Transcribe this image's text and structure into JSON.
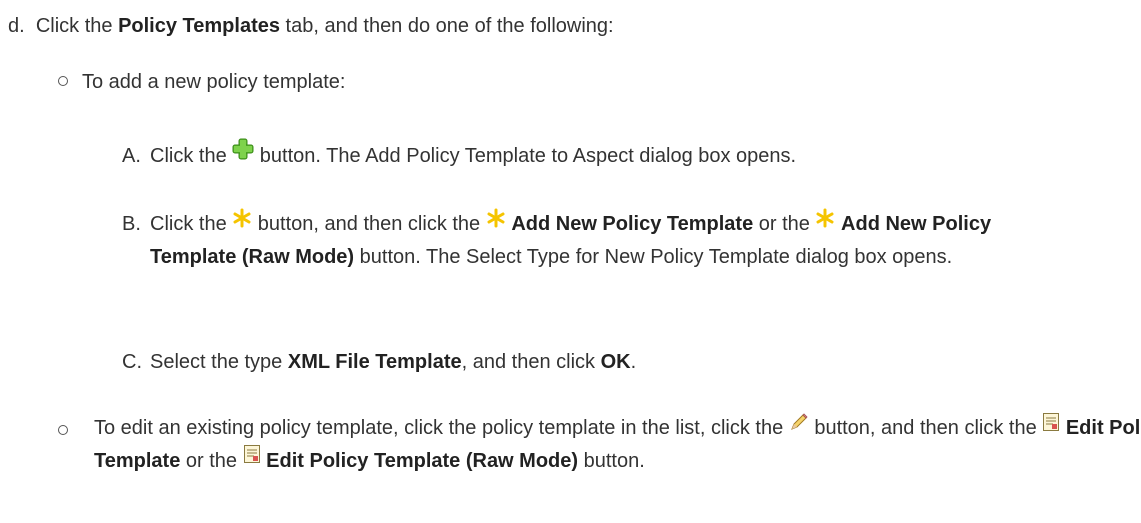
{
  "step_d": {
    "letter": "d.",
    "pre": "Click the ",
    "bold": "Policy Templates",
    "post": " tab, and then do one of the following:"
  },
  "bullet1": {
    "text": "To add a new policy template:"
  },
  "sub_a": {
    "letter": "A.",
    "pre": "Click the ",
    "post": " button. The Add Policy Template to Aspect dialog box opens.",
    "icon": "green-plus-icon"
  },
  "sub_b": {
    "letter": "B.",
    "pre": "Click the ",
    "mid1": " button, and then click the ",
    "bold1": "Add New Policy Template",
    "mid2": " or the ",
    "bold2": "Add New Policy Template (Raw Mode)",
    "post": " button. The Select Type for New Policy Template dialog box opens.",
    "icon": "asterisk-new-icon"
  },
  "sub_c": {
    "letter": "C.",
    "pre": "Select the type ",
    "bold1": "XML File Template",
    "mid": ", and then click ",
    "bold2": "OK",
    "post": "."
  },
  "bullet2": {
    "pre": "To edit an existing policy template, click the policy template in the list, click the ",
    "mid1": " button, and then click the ",
    "bold1": "Edit Policy Template",
    "mid2": " or the ",
    "bold2": "Edit Policy Template (Raw Mode)",
    "post": " button.",
    "icon_edit": "pencil-icon",
    "icon_template": "policy-template-icon"
  },
  "colors": {
    "text": "#333333",
    "plus_green": "#5cb82e",
    "asterisk_yellow": "#f5c400"
  }
}
